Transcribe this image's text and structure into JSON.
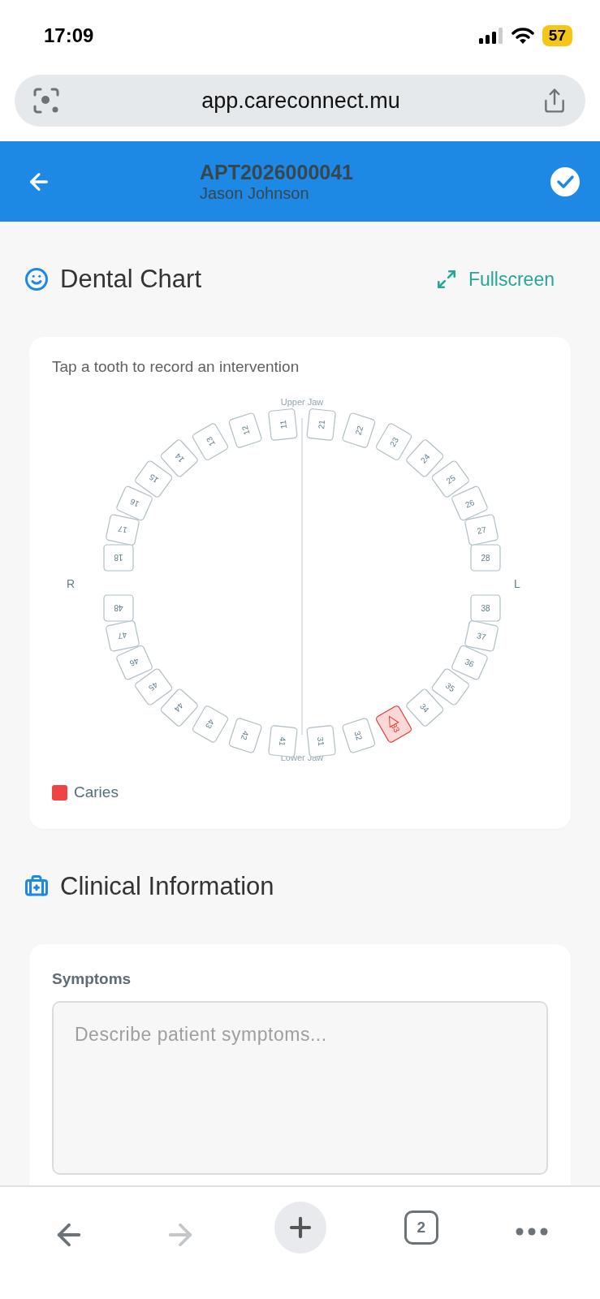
{
  "status_bar": {
    "time": "17:09",
    "battery": "57"
  },
  "browser": {
    "url": "app.careconnect.mu",
    "tab_count": "2",
    "forward_disabled": true
  },
  "header": {
    "title": "APT2026000041",
    "subtitle": "Jason Johnson"
  },
  "dental_chart": {
    "title": "Dental Chart",
    "fullscreen_label": "Fullscreen",
    "hint": "Tap a tooth to record an intervention",
    "upper_label": "Upper Jaw",
    "lower_label": "Lower Jaw",
    "right_label": "R",
    "left_label": "L",
    "upper_right": [
      {
        "number": "11",
        "caries": false
      },
      {
        "number": "12",
        "caries": false
      },
      {
        "number": "13",
        "caries": false
      },
      {
        "number": "14",
        "caries": false
      },
      {
        "number": "15",
        "caries": false
      },
      {
        "number": "16",
        "caries": false
      },
      {
        "number": "17",
        "caries": false
      },
      {
        "number": "18",
        "caries": false
      }
    ],
    "upper_left": [
      {
        "number": "21",
        "caries": false
      },
      {
        "number": "22",
        "caries": false
      },
      {
        "number": "23",
        "caries": false
      },
      {
        "number": "24",
        "caries": false
      },
      {
        "number": "25",
        "caries": false
      },
      {
        "number": "26",
        "caries": false
      },
      {
        "number": "27",
        "caries": false
      },
      {
        "number": "28",
        "caries": false
      }
    ],
    "lower_left": [
      {
        "number": "31",
        "caries": false
      },
      {
        "number": "32",
        "caries": false
      },
      {
        "number": "33",
        "caries": true
      },
      {
        "number": "34",
        "caries": false
      },
      {
        "number": "35",
        "caries": false
      },
      {
        "number": "36",
        "caries": false
      },
      {
        "number": "37",
        "caries": false
      },
      {
        "number": "38",
        "caries": false
      }
    ],
    "lower_right": [
      {
        "number": "41",
        "caries": false
      },
      {
        "number": "42",
        "caries": false
      },
      {
        "number": "43",
        "caries": false
      },
      {
        "number": "44",
        "caries": false
      },
      {
        "number": "45",
        "caries": false
      },
      {
        "number": "46",
        "caries": false
      },
      {
        "number": "47",
        "caries": false
      },
      {
        "number": "48",
        "caries": false
      }
    ],
    "legend": [
      {
        "label": "Caries",
        "color": "#ef4444"
      }
    ]
  },
  "clinical": {
    "title": "Clinical Information",
    "symptoms_label": "Symptoms",
    "symptoms_placeholder": "Describe patient symptoms..."
  }
}
